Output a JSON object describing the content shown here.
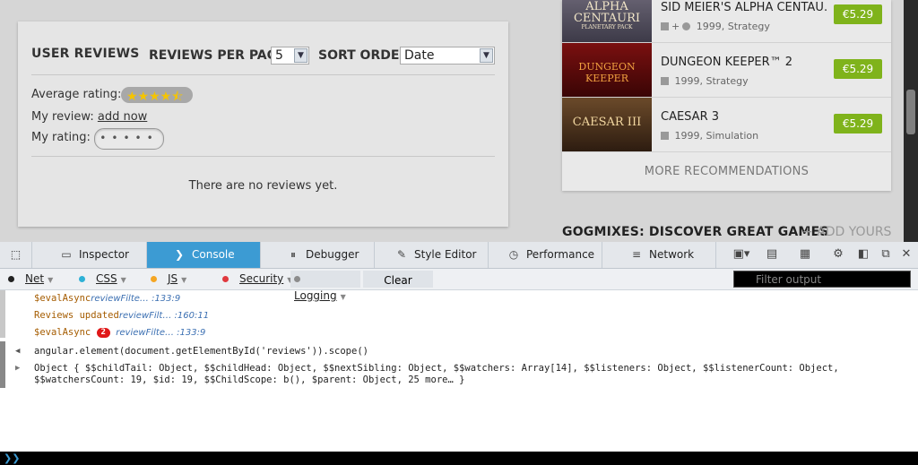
{
  "reviews": {
    "heading": "USER REVIEWS",
    "per_page_label": "REVIEWS PER PAGE",
    "per_page_value": "5",
    "sort_label": "SORT ORDER",
    "sort_value": "Date",
    "avg_label": "Average rating:",
    "avg_stars": "★★★★⯪",
    "my_review_label": "My review:",
    "my_review_link": "add now",
    "my_rating_label": "My rating:",
    "my_rating_dots": "•••••",
    "empty_text": "There are no reviews yet."
  },
  "recommendations": {
    "items": [
      {
        "title": "SID MEIER'S ALPHA CENTAU…",
        "os": "+",
        "year": "1999",
        "genre": "Strategy",
        "price": "€5.29",
        "thumb": "ALPHA CENTAURI",
        "thumb_sub": "PLANETARY PACK"
      },
      {
        "title": "DUNGEON KEEPER™ 2",
        "os": "",
        "year": "1999",
        "genre": "Strategy",
        "price": "€5.29",
        "thumb": "DUNGEON KEEPER",
        "thumb_sub": ""
      },
      {
        "title": "CAESAR 3",
        "os": "",
        "year": "1999",
        "genre": "Simulation",
        "price": "€5.29",
        "thumb": "CAESAR III",
        "thumb_sub": ""
      }
    ],
    "more_label": "MORE RECOMMENDATIONS"
  },
  "gogmixes": {
    "label": "GOGMIXES: DISCOVER GREAT GAMES",
    "add_label": "+ ADD YOURS"
  },
  "devtools": {
    "tabs": [
      {
        "label": "Inspector",
        "icon": "inspector-icon"
      },
      {
        "label": "Console",
        "icon": "console-icon"
      },
      {
        "label": "Debugger",
        "icon": "debugger-icon"
      },
      {
        "label": "Style Editor",
        "icon": "style-editor-icon"
      },
      {
        "label": "Performance",
        "icon": "performance-icon"
      },
      {
        "label": "Network",
        "icon": "network-icon"
      }
    ],
    "filters": {
      "net": "Net",
      "css": "CSS",
      "js": "JS",
      "security": "Security",
      "logging": "Logging",
      "clear": "Clear",
      "filter_placeholder": "Filter output"
    },
    "colors": {
      "net": "#222222",
      "css": "#2eb1d6",
      "js": "#f5a623",
      "security": "#e0393e",
      "logging": "#8c8c8c",
      "accent": "#3c9bd3"
    },
    "log": [
      {
        "text": "$evalAsync",
        "src": "reviewFilte… :133:9"
      },
      {
        "text": "Reviews updated",
        "src": "reviewFilt… :160:11"
      },
      {
        "text": "$evalAsync",
        "badge": "2",
        "src": "reviewFilte… :133:9"
      }
    ],
    "command": "angular.element(document.getElementById('reviews')).scope()",
    "result": "Object { $$childTail: Object, $$childHead: Object, $$nextSibling: Object, $$watchers: Array[14], $$listeners: Object, $$listenerCount: Object, $$watchersCount: 19, $id: 19, $$ChildScope: b(), $parent: Object, 25 more… }"
  }
}
